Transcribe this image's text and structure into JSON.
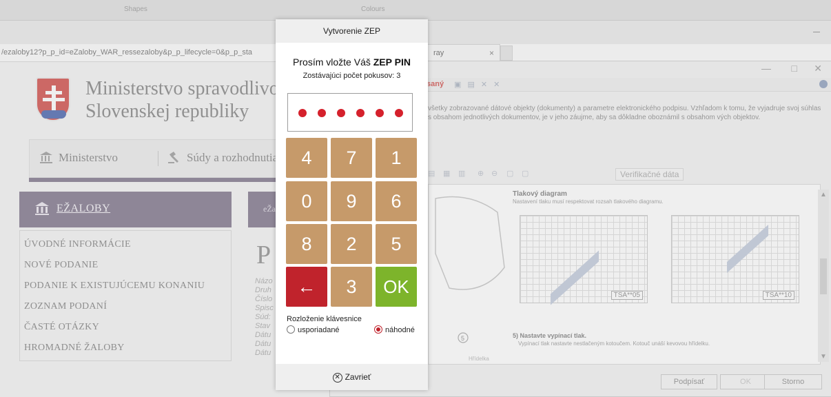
{
  "office_ribbon": {
    "shapes_label": "Shapes",
    "colours_label": "Colours"
  },
  "browser": {
    "url": "/ezaloby12?p_p_id=eZaloby_WAR_ressezaloby&p_p_lifecycle=0&p_p_sta",
    "tab_title": "ray",
    "tab_close": "×"
  },
  "site": {
    "ministry_line1": "Ministerstvo spravodlivos",
    "ministry_line2": "Slovenskej republiky",
    "nav": {
      "item1": "Ministerstvo",
      "item2": "Súdy a rozhodnutia"
    },
    "sidebar": {
      "header": "EŽALOBY",
      "items": [
        "ÚVODNÉ INFORMÁCIE",
        "NOVÉ PODANIE",
        "PODANIE K EXISTUJÚCEMU KONANIU",
        "ZOZNAM PODANÍ",
        "ČASTÉ OTÁZKY",
        "HROMADNÉ ŽALOBY"
      ]
    },
    "ezaloby_tab": "eŽa",
    "page_title_fragment": "P",
    "meta_fragments": [
      "Názo",
      "Druh",
      "Číslo",
      "Spisc",
      "Súd:",
      "Stav",
      "Dátu",
      "Dátu",
      "Dátu"
    ]
  },
  "sign_window": {
    "status": "saný",
    "info": "všetky zobrazované dátové objekty (dokumenty) a parametre elektronického podpisu. Vzhľadom k tomu, že vyjadruje svoj súhlas s obsahom jednotlivých dokumentov, je v jeho záujme, aby sa dôkladne oboznámil s obsahom vých objektov.",
    "verif_button": "Verifikačné dáta",
    "doc": {
      "title": "Tlakový diagram",
      "subtitle": "Nastavení tlaku musí respektovat rozsah tlakového diagramu.",
      "chart1_tag": "TSA**05",
      "chart2_tag": "TSA**10",
      "note_step": "5)  Nastavte vypínací tlak.",
      "note_detail": "Vypínací tlak nastavte nestlačeným kotoučem. Kotouč unáší kevovou hřídelku.",
      "sketch_label": "Hřídelka",
      "sketch_num": "5"
    },
    "buttons": {
      "sign": "Podpísať",
      "ok": "OK",
      "cancel": "Storno"
    }
  },
  "pin_dialog": {
    "title": "Vytvorenie ZEP",
    "prompt_prefix": "Prosím vložte Váš ",
    "prompt_bold": "ZEP PIN",
    "attempts": "Zostávajúci počet pokusov: 3",
    "pin_dots": 6,
    "keys": [
      "4",
      "7",
      "1",
      "0",
      "9",
      "6",
      "8",
      "2",
      "5",
      "←",
      "3",
      "OK"
    ],
    "layout_label": "Rozloženie klávesnice",
    "layout_options": {
      "ordered": "usporiadané",
      "random": "náhodné"
    },
    "layout_selected": "random",
    "close_label": "Zavrieť",
    "colors": {
      "key": "#c69a6a",
      "back": "#c0232c",
      "ok": "#7db42b",
      "dot": "#d5212c"
    }
  }
}
